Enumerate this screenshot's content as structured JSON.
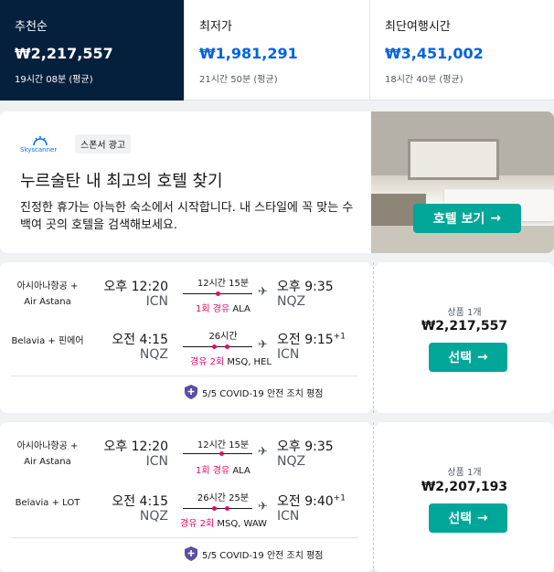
{
  "sort_tabs": [
    {
      "label": "추천순",
      "price": "₩2,217,557",
      "duration": "19시간 08분 (평균)"
    },
    {
      "label": "최저가",
      "price": "₩1,981,291",
      "duration": "21시간 50분 (평균)"
    },
    {
      "label": "최단여행시간",
      "price": "₩3,451,002",
      "duration": "18시간 40분 (평균)"
    }
  ],
  "ad": {
    "logo_text": "Skyscanner",
    "sponsor_label": "스폰서 광고",
    "title": "누르술탄 내 최고의 호텔 찾기",
    "description": "진정한 휴가는 아늑한 숙소에서 시작합니다. 내 스타일에 꼭 맞는 수백여 곳의 호텔을 검색해보세요.",
    "button_label": "호텔 보기"
  },
  "flights": [
    {
      "legs": [
        {
          "airline": "아시아나항공 + Air Astana",
          "dep_time": "오후 12:20",
          "dep_code": "ICN",
          "duration": "12시간 15분",
          "stops_count": "1회 경유",
          "stops_via": "ALA",
          "arr_time": "오후 9:35",
          "arr_code": "NQZ",
          "day_offset": ""
        },
        {
          "airline": "Belavia + 핀에어",
          "dep_time": "오전 4:15",
          "dep_code": "NQZ",
          "duration": "26시간",
          "stops_count": "경유 2회",
          "stops_via": "MSQ, HEL",
          "arr_time": "오전 9:15",
          "arr_code": "ICN",
          "day_offset": "+1"
        }
      ],
      "covid": "5/5 COVID-19 안전 조치 평점",
      "deal_count": "상품 1개",
      "price": "₩2,217,557",
      "select_label": "선택"
    },
    {
      "legs": [
        {
          "airline": "아시아나항공 + Air Astana",
          "dep_time": "오후 12:20",
          "dep_code": "ICN",
          "duration": "12시간 15분",
          "stops_count": "1회 경유",
          "stops_via": "ALA",
          "arr_time": "오후 9:35",
          "arr_code": "NQZ",
          "day_offset": ""
        },
        {
          "airline": "Belavia + LOT",
          "dep_time": "오전 4:15",
          "dep_code": "NQZ",
          "duration": "26시간 25분",
          "stops_count": "경유 2회",
          "stops_via": "MSQ, WAW",
          "arr_time": "오전 9:40",
          "arr_code": "ICN",
          "day_offset": "+1"
        }
      ],
      "covid": "5/5 COVID-19 안전 조치 평점",
      "deal_count": "상품 1개",
      "price": "₩2,207,193",
      "select_label": "선택"
    }
  ],
  "colors": {
    "selected_tab": "#05203c",
    "price_blue": "#0062e3",
    "cta_green": "#00a698",
    "stop_pink": "#e70866"
  }
}
